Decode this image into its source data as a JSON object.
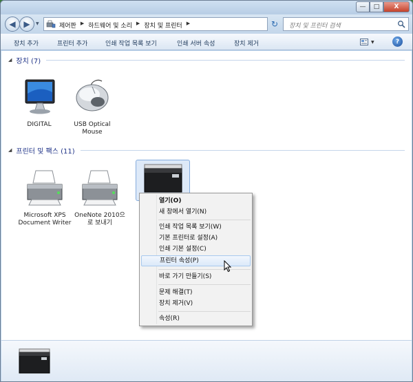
{
  "window": {
    "caption_buttons": {
      "minimize": "—",
      "maximize": "□",
      "close": "X"
    }
  },
  "address": {
    "back_glyph": "◀",
    "forward_glyph": "▶",
    "crumbs": [
      "제어판",
      "하드웨어 및 소리",
      "장치 및 프린터"
    ],
    "separator": "▶",
    "dropdown_glyph": "▼",
    "refresh_glyph": "↻"
  },
  "search": {
    "placeholder": "장치 및 프린터 검색"
  },
  "toolbar": {
    "items": [
      "장치 추가",
      "프린터 추가",
      "인쇄 작업 목록 보기",
      "인쇄 서버 속성",
      "장치 제거"
    ],
    "help": "?"
  },
  "groups": {
    "devices": {
      "arrow": "◢",
      "title": "장치 (7)"
    },
    "printers": {
      "arrow": "◢",
      "title": "프린터 및 팩스 (11)"
    }
  },
  "devices": [
    {
      "label": "DIGITAL",
      "icon": "monitor-icon"
    },
    {
      "label": "USB Optical Mouse",
      "icon": "mouse-icon"
    }
  ],
  "printers": [
    {
      "label": "Microsoft XPS Document Writer",
      "icon": "printer-icon"
    },
    {
      "label": "OneNote 2010으로 보내기",
      "icon": "printer-icon"
    },
    {
      "label": "",
      "icon": "laser-printer-icon"
    }
  ],
  "context_menu": {
    "items": [
      "열기(O)",
      "새 창에서 열기(N)",
      "인쇄 작업 목록 보기(W)",
      "기본 프린터로 설정(A)",
      "인쇄 기본 설정(C)",
      "프린터 속성(P)",
      "바로 가기 만들기(S)",
      "문제 해결(T)",
      "장치 제거(V)",
      "속성(R)"
    ],
    "highlighted": "프린터 속성(P)"
  },
  "colors": {
    "group_title": "#1e3287",
    "selection": "#dde9f8",
    "toolbar_text": "#1e395b"
  }
}
